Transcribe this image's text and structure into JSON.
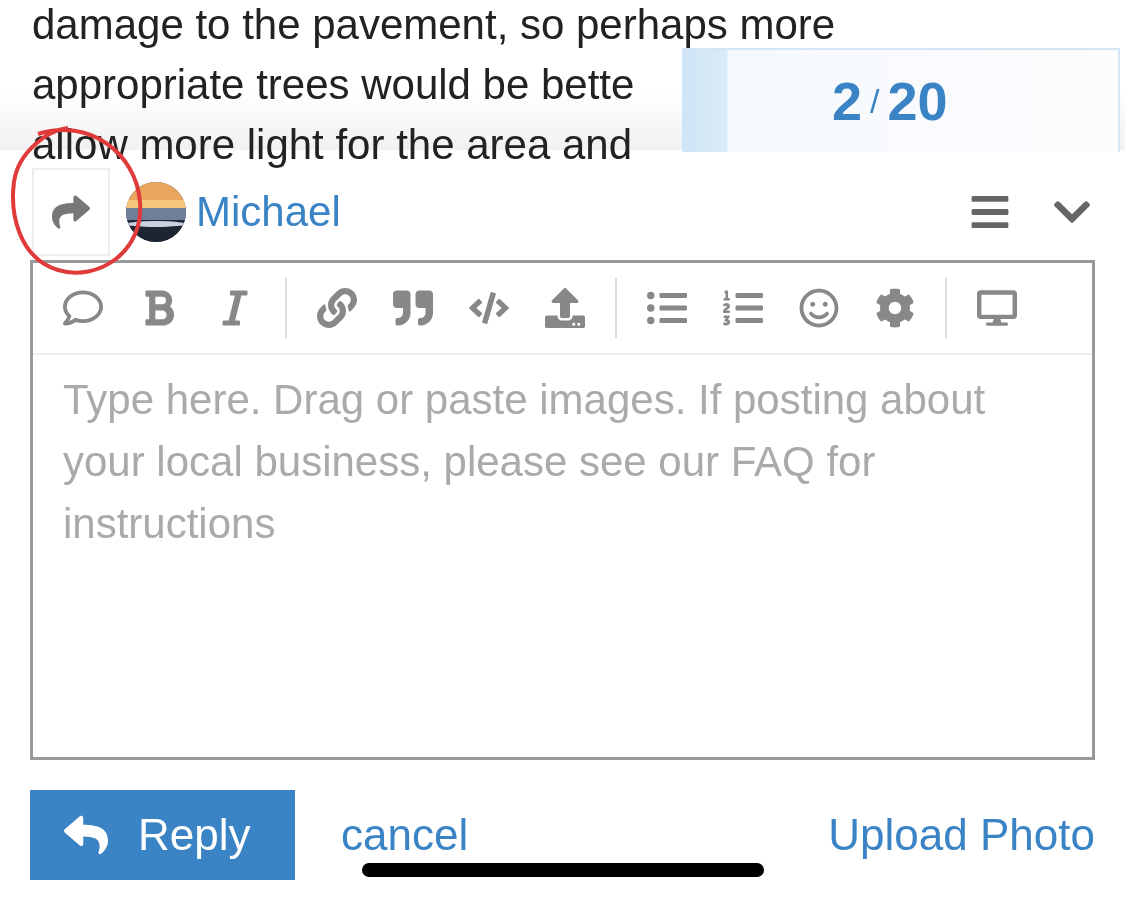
{
  "post_text": [
    "damage to the pavement, so perhaps more",
    "appropriate trees would be bette",
    "allow more light for the area and"
  ],
  "progress": {
    "current": "2",
    "separator": "/",
    "total": "20"
  },
  "composer": {
    "user": "Michael",
    "toolbar": [
      [
        {
          "kind": "comment"
        },
        {
          "kind": "bold"
        },
        {
          "kind": "italic"
        }
      ],
      [
        {
          "kind": "link"
        },
        {
          "kind": "quote"
        },
        {
          "kind": "code"
        },
        {
          "kind": "upload"
        }
      ],
      [
        {
          "kind": "bullet-list"
        },
        {
          "kind": "numbered-list"
        },
        {
          "kind": "emoji"
        },
        {
          "kind": "settings"
        }
      ],
      [
        {
          "kind": "preview"
        }
      ]
    ],
    "placeholder": "Type here. Drag or paste images. If posting about your local business, please see our FAQ for instructions"
  },
  "actions": {
    "reply": "Reply",
    "cancel": "cancel",
    "upload": "Upload Photo"
  }
}
